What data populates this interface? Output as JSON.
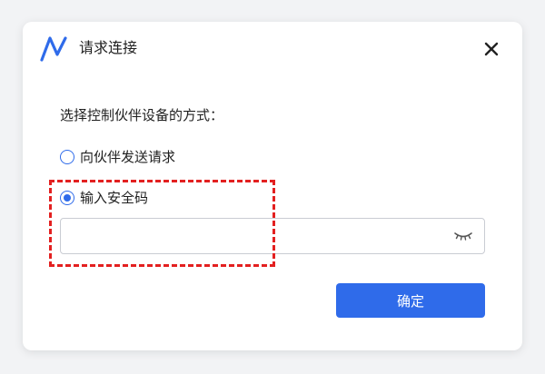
{
  "dialog": {
    "title": "请求连接",
    "prompt": "选择控制伙伴设备的方式：",
    "options": [
      {
        "label": "向伙伴发送请求",
        "selected": false
      },
      {
        "label": "输入安全码",
        "selected": true
      }
    ],
    "security_code": {
      "value": "",
      "placeholder": ""
    },
    "confirm_label": "确定"
  },
  "colors": {
    "accent": "#2f6bea",
    "highlight": "#e32020"
  },
  "icons": {
    "logo": "app-logo-icon",
    "close": "close-icon",
    "eye": "eye-closed-icon"
  }
}
